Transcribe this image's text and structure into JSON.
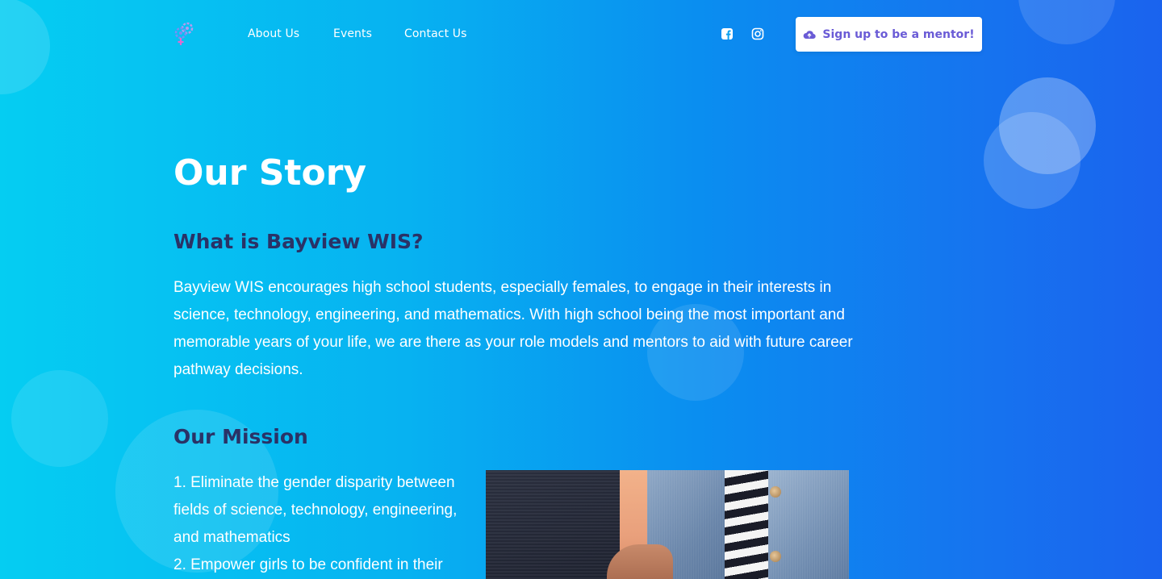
{
  "nav": {
    "links": [
      {
        "label": "About Us"
      },
      {
        "label": "Events"
      },
      {
        "label": "Contact Us"
      }
    ],
    "social": [
      "facebook-icon",
      "instagram-icon"
    ],
    "cta_label": "Sign up to be a mentor!",
    "cta_icon": "cloud-upload-icon"
  },
  "logo": {
    "icon": "female-gear-logo"
  },
  "main": {
    "title": "Our Story",
    "what_heading": "What is Bayview WIS?",
    "what_body": "Bayview WIS encourages high school students, especially females, to engage in their interests in science, technology, engineering, and mathematics. With high school being the most important and memorable years of your life, we are there as your role models and mentors to aid with future career pathway decisions.",
    "mission_heading": "Our Mission",
    "mission_items": [
      "1. Eliminate the gender disparity between fields of science, technology, engineering, and mathematics",
      "2. Empower girls to be confident in their"
    ]
  },
  "colors": {
    "heading_dark": "#2a3266",
    "cta_text": "#6a5bd6",
    "gradient_start": "#05cdf2",
    "gradient_end": "#1a63ee"
  }
}
